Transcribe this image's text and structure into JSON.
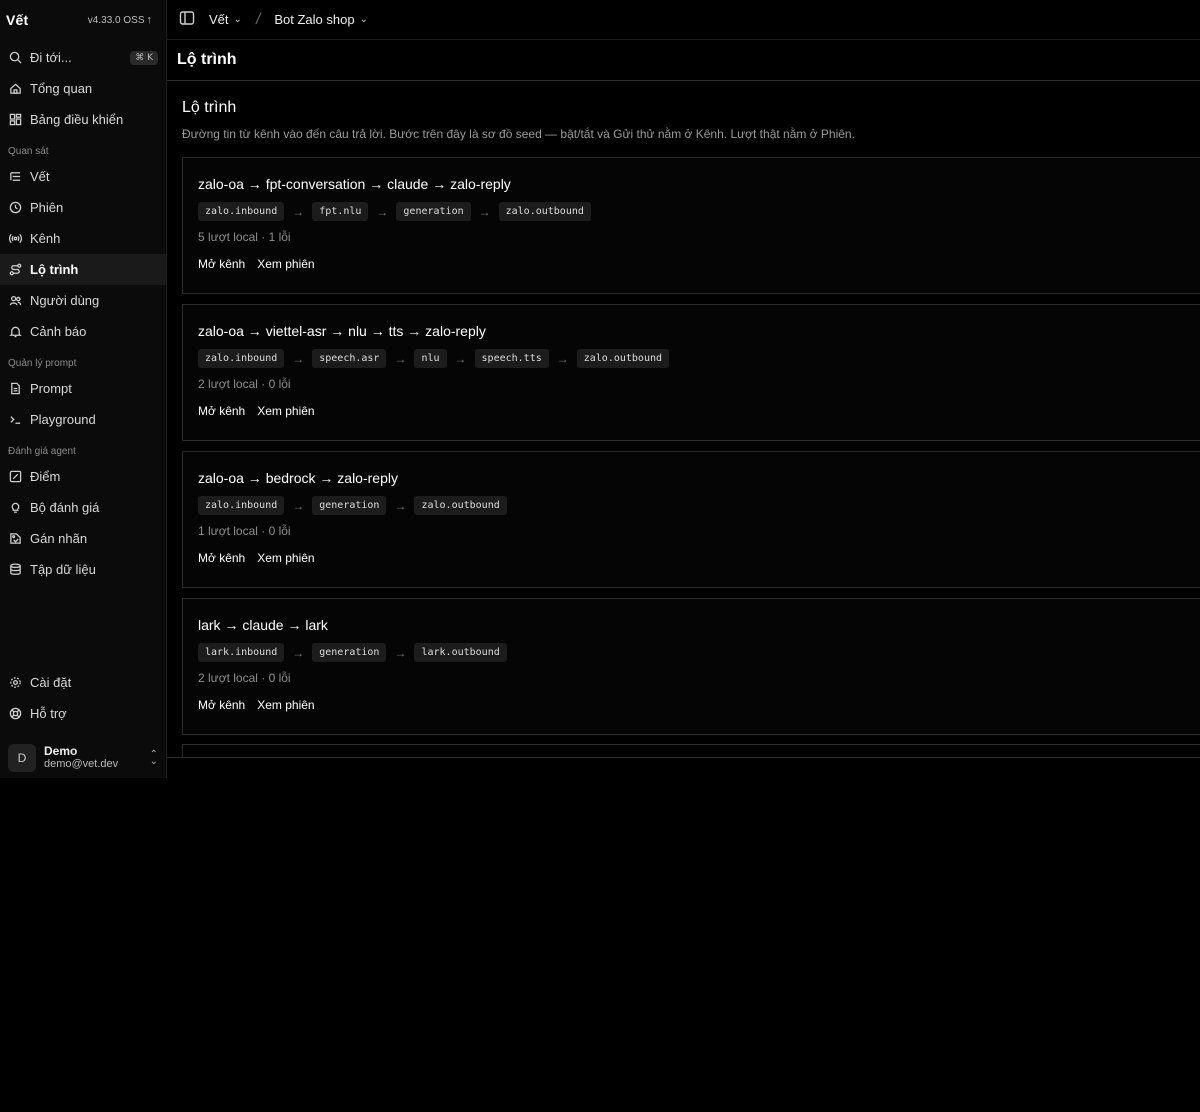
{
  "app": {
    "name": "Vết",
    "version": "v4.33.0 OSS"
  },
  "search": {
    "label": "Đi tới...",
    "shortcut": "⌘ K"
  },
  "sidebar": {
    "top_items": [
      {
        "label": "Tổng quan",
        "icon": "home-icon"
      },
      {
        "label": "Bảng điều khiển",
        "icon": "dashboard-icon"
      }
    ],
    "sections": [
      {
        "label": "Quan sát",
        "items": [
          {
            "label": "Vết",
            "icon": "trace-list-icon"
          },
          {
            "label": "Phiên",
            "icon": "clock-icon"
          },
          {
            "label": "Kênh",
            "icon": "broadcast-icon"
          },
          {
            "label": "Lộ trình",
            "icon": "route-icon",
            "active": true
          },
          {
            "label": "Người dùng",
            "icon": "users-icon"
          },
          {
            "label": "Cảnh báo",
            "icon": "bell-icon"
          }
        ]
      },
      {
        "label": "Quản lý prompt",
        "items": [
          {
            "label": "Prompt",
            "icon": "file-icon"
          },
          {
            "label": "Playground",
            "icon": "terminal-icon"
          }
        ]
      },
      {
        "label": "Đánh giá agent",
        "items": [
          {
            "label": "Điểm",
            "icon": "score-icon"
          },
          {
            "label": "Bộ đánh giá",
            "icon": "lightbulb-icon"
          },
          {
            "label": "Gán nhãn",
            "icon": "label-icon"
          },
          {
            "label": "Tập dữ liệu",
            "icon": "database-icon"
          }
        ]
      }
    ],
    "bottom_items": [
      {
        "label": "Cài đặt",
        "icon": "gear-icon"
      },
      {
        "label": "Hỗ trợ",
        "icon": "lifebuoy-icon"
      }
    ],
    "user": {
      "initial": "D",
      "name": "Demo",
      "email": "demo@vet.dev"
    }
  },
  "topbar": {
    "crumb1": "Vết",
    "crumb2": "Bot Zalo shop"
  },
  "page": {
    "header_title": "Lộ trình",
    "title": "Lộ trình",
    "description": "Đường tin từ kênh vào đến câu trả lời. Bước trên đây là sơ đồ seed — bật/tắt và Gửi thử nằm ở Kênh. Lượt thật nằm ở Phiên."
  },
  "routes": [
    {
      "title": "zalo-oa → fpt-conversation → claude → zalo-reply",
      "steps": [
        "zalo.inbound",
        "fpt.nlu",
        "generation",
        "zalo.outbound"
      ],
      "stats": "5 lượt local · 1 lỗi",
      "open_channel": "Mở kênh",
      "view_sessions": "Xem phiên"
    },
    {
      "title": "zalo-oa → viettel-asr → nlu → tts → zalo-reply",
      "steps": [
        "zalo.inbound",
        "speech.asr",
        "nlu",
        "speech.tts",
        "zalo.outbound"
      ],
      "stats": "2 lượt local · 0 lỗi",
      "open_channel": "Mở kênh",
      "view_sessions": "Xem phiên"
    },
    {
      "title": "zalo-oa → bedrock → zalo-reply",
      "steps": [
        "zalo.inbound",
        "generation",
        "zalo.outbound"
      ],
      "stats": "1 lượt local · 0 lỗi",
      "open_channel": "Mở kênh",
      "view_sessions": "Xem phiên"
    },
    {
      "title": "lark → claude → lark",
      "steps": [
        "lark.inbound",
        "generation",
        "lark.outbound"
      ],
      "stats": "2 lượt local · 0 lỗi",
      "open_channel": "Mở kênh",
      "view_sessions": "Xem phiên"
    }
  ],
  "arrow_glyph": "→"
}
